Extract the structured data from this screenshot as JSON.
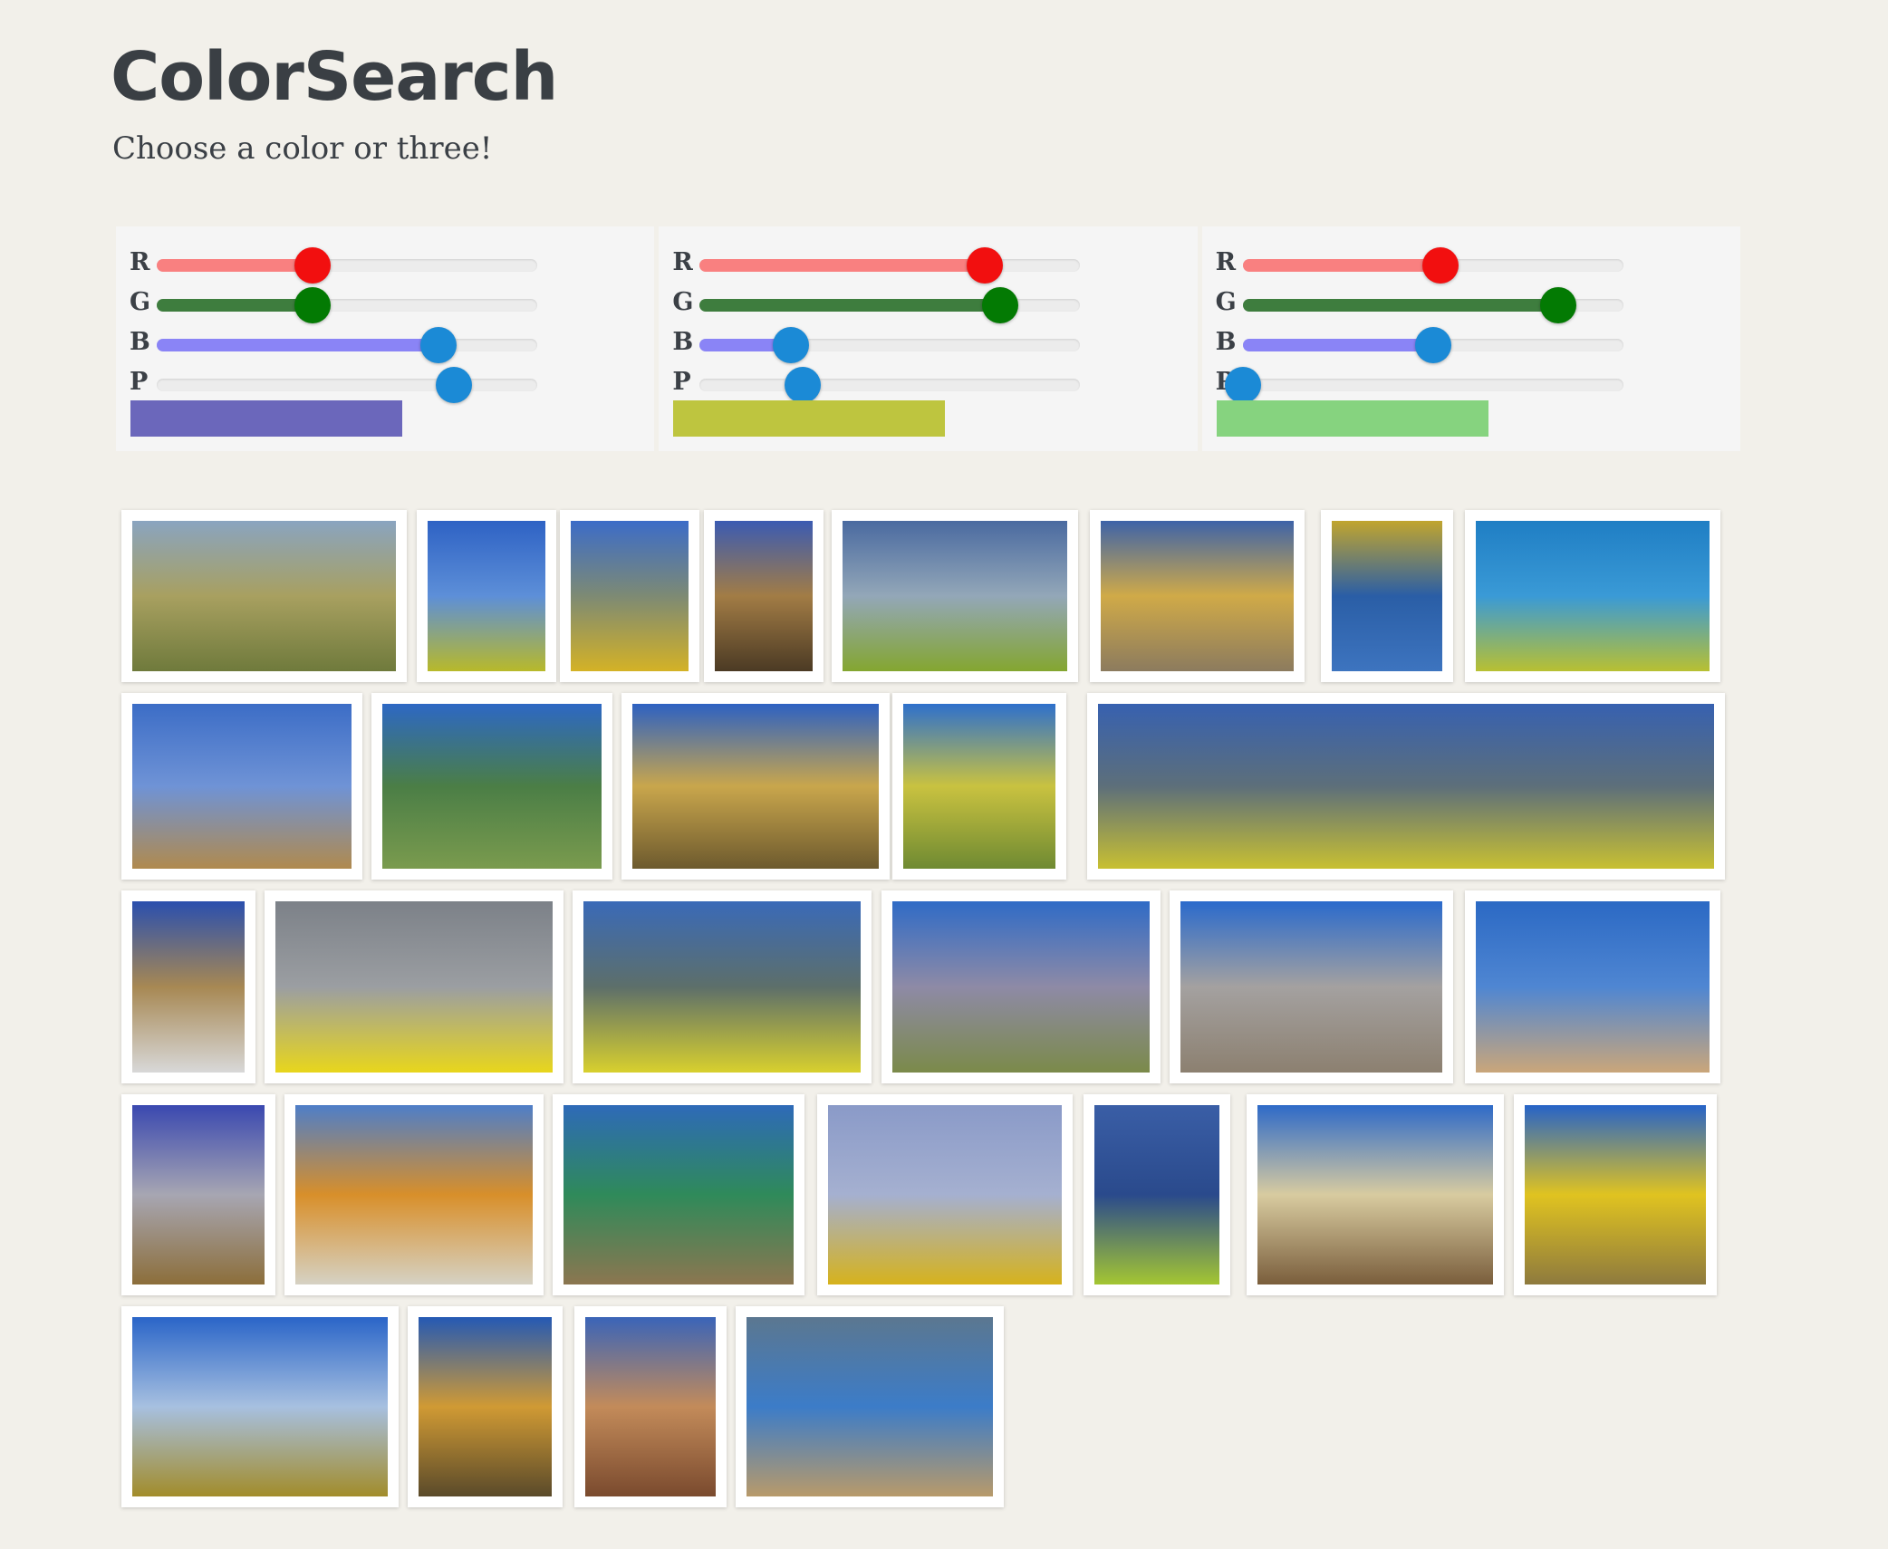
{
  "header": {
    "title": "ColorSearch",
    "subtitle": "Choose a color or three!"
  },
  "panels": [
    {
      "labels": [
        "R",
        "G",
        "B",
        "P"
      ],
      "values": {
        "R": 0.41,
        "G": 0.41,
        "B": 0.74,
        "P": 0.78
      },
      "fill_colors": {
        "R": "#f98080",
        "G": "#3e7d3e",
        "B": "#8a84f6",
        "P": "none"
      },
      "thumb_colors": {
        "R": "#f20f0f",
        "G": "#037a03",
        "B": "#1b8ad6",
        "P": "#1b8ad6"
      },
      "swatch_color": "#6b67bb"
    },
    {
      "labels": [
        "R",
        "G",
        "B",
        "P"
      ],
      "values": {
        "R": 0.75,
        "G": 0.79,
        "B": 0.24,
        "P": 0.27
      },
      "fill_colors": {
        "R": "#f98080",
        "G": "#3e7d3e",
        "B": "#8a84f6",
        "P": "none"
      },
      "thumb_colors": {
        "R": "#f20f0f",
        "G": "#037a03",
        "B": "#1b8ad6",
        "P": "#1b8ad6"
      },
      "swatch_color": "#bec53f"
    },
    {
      "labels": [
        "R",
        "G",
        "B",
        "P"
      ],
      "values": {
        "R": 0.52,
        "G": 0.83,
        "B": 0.5,
        "P": 0.0
      },
      "fill_colors": {
        "R": "#f98080",
        "G": "#3e7d3e",
        "B": "#8a84f6",
        "P": "none"
      },
      "thumb_colors": {
        "R": "#f20f0f",
        "G": "#037a03",
        "B": "#1b8ad6",
        "P": "#1b8ad6"
      },
      "swatch_color": "#86d37f"
    }
  ],
  "gallery": {
    "rows": [
      [
        {
          "name": "mountain-landscape",
          "colors": [
            "#8aa4c0",
            "#a8a060",
            "#6f7a3c"
          ]
        },
        {
          "name": "yellow-flowers-sky",
          "colors": [
            "#2e62c4",
            "#5d8fd8",
            "#b8b92a"
          ]
        },
        {
          "name": "tower-yellow-bush",
          "colors": [
            "#3c6cc8",
            "#7d8a74",
            "#d4b226"
          ]
        },
        {
          "name": "cathedral-facade",
          "colors": [
            "#3b5bb2",
            "#a27c45",
            "#4b3a24"
          ]
        },
        {
          "name": "green-hill-building",
          "colors": [
            "#4a6aa0",
            "#93a7b8",
            "#84a630"
          ]
        },
        {
          "name": "yellow-church",
          "colors": [
            "#3e63a8",
            "#d0aa48",
            "#8c7b5e"
          ]
        },
        {
          "name": "river-autumn",
          "colors": [
            "#c1a52e",
            "#2a5ea6",
            "#3d74bf"
          ]
        },
        {
          "name": "aquarium-fish",
          "colors": [
            "#1f7ec4",
            "#3a9ad6",
            "#b8c032"
          ]
        }
      ],
      [
        {
          "name": "mesa-hill",
          "colors": [
            "#3c6dc6",
            "#6f93d6",
            "#b08a4e"
          ]
        },
        {
          "name": "bamboo-leaves",
          "colors": [
            "#2d68c4",
            "#4b7e46",
            "#7a9b4e"
          ]
        },
        {
          "name": "golden-temple",
          "colors": [
            "#2d61c2",
            "#c9a64c",
            "#6d5a2e"
          ]
        },
        {
          "name": "yellow-tree",
          "colors": [
            "#2e70cc",
            "#c9c240",
            "#6f8a32"
          ]
        },
        {
          "name": "rapeseed-field-panorama",
          "colors": [
            "#3761b0",
            "#5d6f7a",
            "#c8c032"
          ]
        }
      ],
      [
        {
          "name": "minaret-tower",
          "colors": [
            "#2a4fae",
            "#a78853",
            "#d8d8d8"
          ]
        },
        {
          "name": "spirit-airplane",
          "colors": [
            "#7c8188",
            "#9b9ea2",
            "#e8d61c"
          ]
        },
        {
          "name": "mountain-yellow-field",
          "colors": [
            "#3a6ab8",
            "#5d6f6a",
            "#d8d02e"
          ]
        },
        {
          "name": "volcano-plains",
          "colors": [
            "#2f6bc6",
            "#8e8aa6",
            "#7b8a4a"
          ]
        },
        {
          "name": "city-skyscrapers",
          "colors": [
            "#2a6acc",
            "#a4a1a0",
            "#8c8070"
          ]
        },
        {
          "name": "man-sunglasses",
          "colors": [
            "#2b69c4",
            "#4f86d2",
            "#caa67a"
          ]
        }
      ],
      [
        {
          "name": "shopping-arcade",
          "colors": [
            "#3a48b0",
            "#a7a6b2",
            "#8c6e3a"
          ]
        },
        {
          "name": "beach-danger-sign",
          "colors": [
            "#4e7ec8",
            "#d88f2a",
            "#d6d2c4"
          ]
        },
        {
          "name": "berlin-cathedral",
          "colors": [
            "#2e6ab8",
            "#2f8a5a",
            "#8c7650"
          ]
        },
        {
          "name": "yellow-boat-models",
          "colors": [
            "#8a9ac8",
            "#a5b0d0",
            "#d6b21c"
          ]
        },
        {
          "name": "lily-pads-water",
          "colors": [
            "#3a5ea6",
            "#2a4a8c",
            "#a4c632"
          ]
        },
        {
          "name": "white-temple",
          "colors": [
            "#2e6ac8",
            "#d8cba0",
            "#7a5e3c"
          ]
        },
        {
          "name": "yellow-blossom-tree",
          "colors": [
            "#2663c8",
            "#e0c320",
            "#8e7a3e"
          ]
        }
      ],
      [
        {
          "name": "grassy-hill-cloud",
          "colors": [
            "#2a65c8",
            "#a7c0e0",
            "#a28c2a"
          ]
        },
        {
          "name": "yellow-building",
          "colors": [
            "#2459b4",
            "#d09a34",
            "#5a4a2a"
          ]
        },
        {
          "name": "ornate-tower",
          "colors": [
            "#3a64b8",
            "#c38b5a",
            "#7a4a2e"
          ]
        },
        {
          "name": "bird-on-stone",
          "colors": [
            "#5b7790",
            "#3c7cc8",
            "#b89a6a"
          ]
        }
      ]
    ]
  }
}
